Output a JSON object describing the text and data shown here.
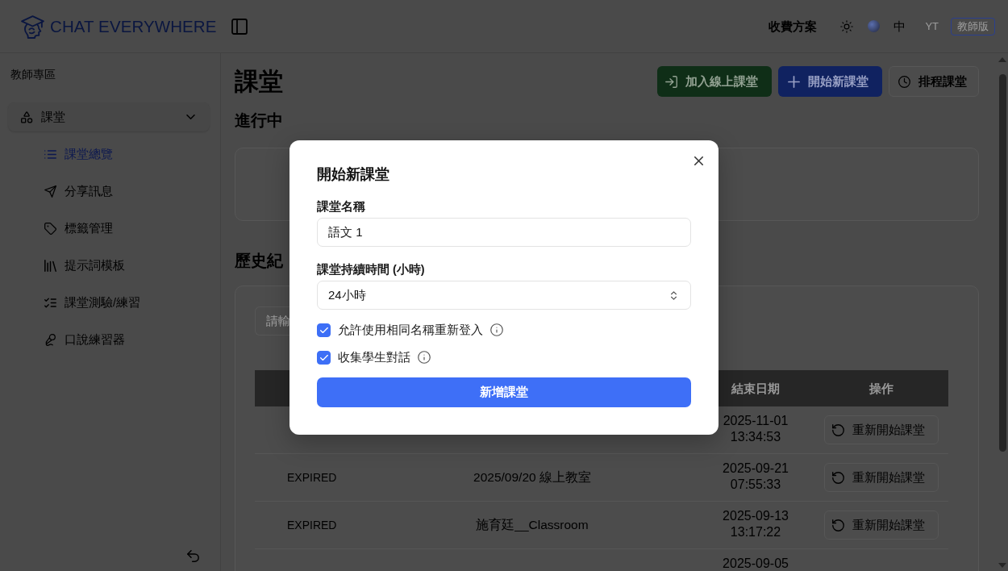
{
  "header": {
    "logo": "CHAT EVERYWHERE",
    "pricing_link": "收費方案",
    "language": "中",
    "avatar": "YT",
    "badge": "教師版"
  },
  "sidebar": {
    "title": "教師專區",
    "items": [
      {
        "label": "課堂",
        "expanded": true,
        "children": [
          {
            "label": "課堂總覽",
            "selected": true
          },
          {
            "label": "分享訊息",
            "selected": false
          },
          {
            "label": "標籤管理",
            "selected": false
          },
          {
            "label": "提示詞模板",
            "selected": false
          },
          {
            "label": "課堂測驗/練習",
            "selected": false
          },
          {
            "label": "口說練習器",
            "selected": false
          }
        ]
      }
    ]
  },
  "main": {
    "title": "課堂",
    "actions": [
      {
        "kind": "join",
        "label": "加入線上課堂"
      },
      {
        "kind": "start",
        "label": "開始新課堂"
      },
      {
        "kind": "schedule",
        "label": "排程課堂"
      }
    ],
    "ongoing": {
      "heading": "進行中"
    },
    "history": {
      "heading": "歷史紀",
      "search": {
        "placeholder": "請輸"
      },
      "table": {
        "columns": {
          "column_3": "結束日期",
          "column_4": "操作"
        },
        "rows": [
          {
            "column_3": "2025-11-01 13:34:53",
            "column_4": "重新開始課堂"
          },
          {
            "column_1": "EXPIRED",
            "column_2": "2025/09/20 線上教室",
            "column_3": "2025-09-21 07:55:33",
            "column_4": "重新開始課堂"
          },
          {
            "column_1": "EXPIRED",
            "column_2": "施育廷__Classroom",
            "column_3": "2025-09-13 13:17:22",
            "column_4": "重新開始課堂"
          },
          {
            "column_3": "2025-09-05"
          }
        ]
      }
    }
  },
  "dialog": {
    "title": "開始新課堂",
    "fields": [
      {
        "kind": "text",
        "label": "課堂名稱",
        "value": "語文 1"
      },
      {
        "kind": "select",
        "label": "課堂持續時間 (小時)",
        "value": "24小時"
      }
    ],
    "options": [
      {
        "label": "允許使用相同名稱重新登入",
        "checked": true
      },
      {
        "label": "收集學生對話",
        "checked": true
      }
    ],
    "submit": "新增課堂"
  }
}
